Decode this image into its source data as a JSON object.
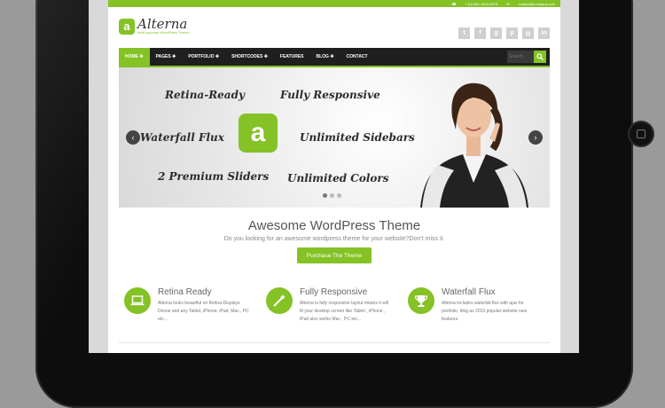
{
  "topbar": {
    "phone": "+ (0) 800-1234-5678",
    "email": "contact@company.com"
  },
  "logo": {
    "name": "Alterna",
    "tagline": "Multi-purpose WordPress Theme",
    "mark": "a"
  },
  "socials": [
    "twitter-icon",
    "facebook-icon",
    "google-plus-icon",
    "pinterest-icon",
    "dribbble-icon",
    "linkedin-icon"
  ],
  "nav": {
    "items": [
      {
        "label": "HOME ✚"
      },
      {
        "label": "PAGES ✚"
      },
      {
        "label": "PORTFOLIO ✚"
      },
      {
        "label": "SHORTCODES ✚"
      },
      {
        "label": "FEATURES"
      },
      {
        "label": "BLOG ✚"
      },
      {
        "label": "CONTACT"
      }
    ],
    "search_placeholder": "Search"
  },
  "slider": {
    "features": [
      "Retina-Ready",
      "Fully Responsive",
      "Waterfall Flux",
      "Unlimited Sidebars",
      "2 Premium Sliders",
      "Unlimited Colors"
    ],
    "logo_mark": "a",
    "prev": "‹",
    "next": "›",
    "slides_total": 3,
    "active_slide": 1
  },
  "hero": {
    "title": "Awesome WordPress Theme",
    "subtitle": "Do you looking for an awesome wordpress theme for your website?Don't miss it.",
    "button": "Purchase The Theme"
  },
  "features": [
    {
      "icon": "laptop-icon",
      "title": "Retina Ready",
      "text": "Alterna looks beautiful on Retina-Displays Devoe and any Tablet, iPhone, iPad, Mac., PC etc..."
    },
    {
      "icon": "magic-wand-icon",
      "title": "Fully Responsive",
      "text": "Alterna is fully responsive layout means it will fit your desktop screen like Tablet , iPhone , iPad also works Mac , PC etc..."
    },
    {
      "icon": "trophy-icon",
      "title": "Waterfall Flux",
      "text": "Alterna includes waterfall flux with ajax for portfolio, blog as 2013 popular website new features."
    }
  ],
  "colors": {
    "accent": "#84c225",
    "nav_bg": "#1f1f1f",
    "device": "#0d0d0d"
  }
}
